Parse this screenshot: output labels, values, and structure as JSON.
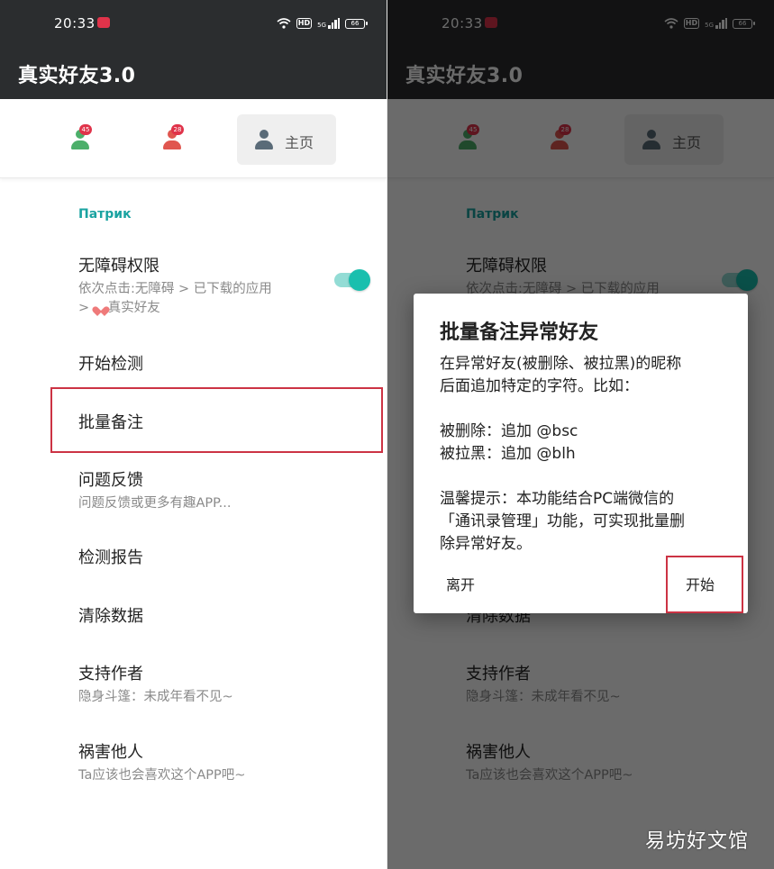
{
  "status_bar": {
    "time": "20:33",
    "hd": "HD",
    "network": "5G",
    "battery": "66"
  },
  "app_bar": {
    "title": "真实好友3.0"
  },
  "tabs": {
    "tab1_badge": "45",
    "tab2_badge": "28",
    "home_label": "主页"
  },
  "settings": {
    "section_label": "Патрик",
    "items": [
      {
        "title": "无障碍权限",
        "subtitle_line1": "依次点击:无障碍 > 已下载的应用",
        "subtitle_line2_prefix": ">",
        "subtitle_line2_suffix": "真实好友",
        "toggle_on": true
      },
      {
        "title": "开始检测"
      },
      {
        "title": "批量备注"
      },
      {
        "title": "问题反馈",
        "subtitle": "问题反馈或更多有趣APP..."
      },
      {
        "title": "检测报告"
      },
      {
        "title": "清除数据"
      },
      {
        "title": "支持作者",
        "subtitle": "隐身斗篷：未成年看不见~"
      },
      {
        "title": "祸害他人",
        "subtitle": "Ta应该也会喜欢这个APP吧~"
      }
    ]
  },
  "dialog": {
    "title": "批量备注异常好友",
    "line1": "在异常好友(被删除、被拉黑)的昵称",
    "line2": "后面追加特定的字符。比如：",
    "deleted_line": "被删除：追加 @bsc",
    "blocked_line": "被拉黑：追加 @blh",
    "tip_line1": "温馨提示：本功能结合PC端微信的",
    "tip_line2": "「通讯录管理」功能，可实现批量删",
    "tip_line3": "除异常好友。",
    "leave_label": "离开",
    "start_label": "开始"
  },
  "watermark": "易坊好文馆",
  "colors": {
    "accent": "#1aa3a1",
    "toggle": "#1abfae",
    "badge": "#e0334a",
    "highlight": "#cc3344",
    "tab1_icon": "#4caf6a",
    "tab2_icon": "#e0564f",
    "home_icon": "#5a6b78"
  }
}
